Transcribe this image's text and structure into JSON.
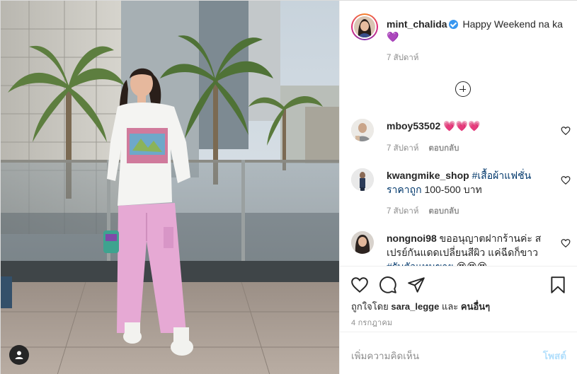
{
  "post": {
    "author": "mint_chalida",
    "caption": "Happy Weekend na ka 💜",
    "caption_time": "7 สัปดาห์"
  },
  "comments": [
    {
      "username": "mboy53502",
      "parts": [
        {
          "text": "💗💗💗",
          "tag": false
        }
      ],
      "time": "7 สัปดาห์",
      "reply": "ตอบกลับ"
    },
    {
      "username": "kwangmike_shop",
      "parts": [
        {
          "text": "#เสื้อผ้าแฟชั่น",
          "tag": true
        },
        {
          "text": " ",
          "tag": false
        },
        {
          "text": "ราคาถูก",
          "tag": true
        },
        {
          "text": " 100-500 บาท",
          "tag": false
        }
      ],
      "time": "7 สัปดาห์",
      "reply": "ตอบกลับ"
    },
    {
      "username": "nongnoi98",
      "parts": [
        {
          "text": "ขออนุญาตฝากร้านค่ะ สเปรย์กันแดดเปลี่ยนสีผิว แค่ฉีดก็ขาว ",
          "tag": false
        },
        {
          "text": "#รับตัวแทนขาย",
          "tag": true
        },
        {
          "text": " 😍😍😍",
          "tag": false
        }
      ],
      "time": "",
      "reply": ""
    }
  ],
  "actions": {
    "liked_prefix": "ถูกใจโดย",
    "liked_user": "sara_legge",
    "liked_join": "และ",
    "liked_others": "คนอื่นๆ",
    "date": "4 กรกฎาคม"
  },
  "composer": {
    "placeholder": "เพิ่มความคิดเห็น",
    "post_label": "โพสต์"
  },
  "icons": [
    "user-tag-icon",
    "add-icon",
    "heart-icon",
    "comment-icon",
    "share-icon",
    "bookmark-icon",
    "verified-icon"
  ],
  "colors": {
    "accent": "#3897f0",
    "muted": "#8e8e8e",
    "hashtag": "#00376b",
    "post_disabled": "#b2dffc"
  }
}
